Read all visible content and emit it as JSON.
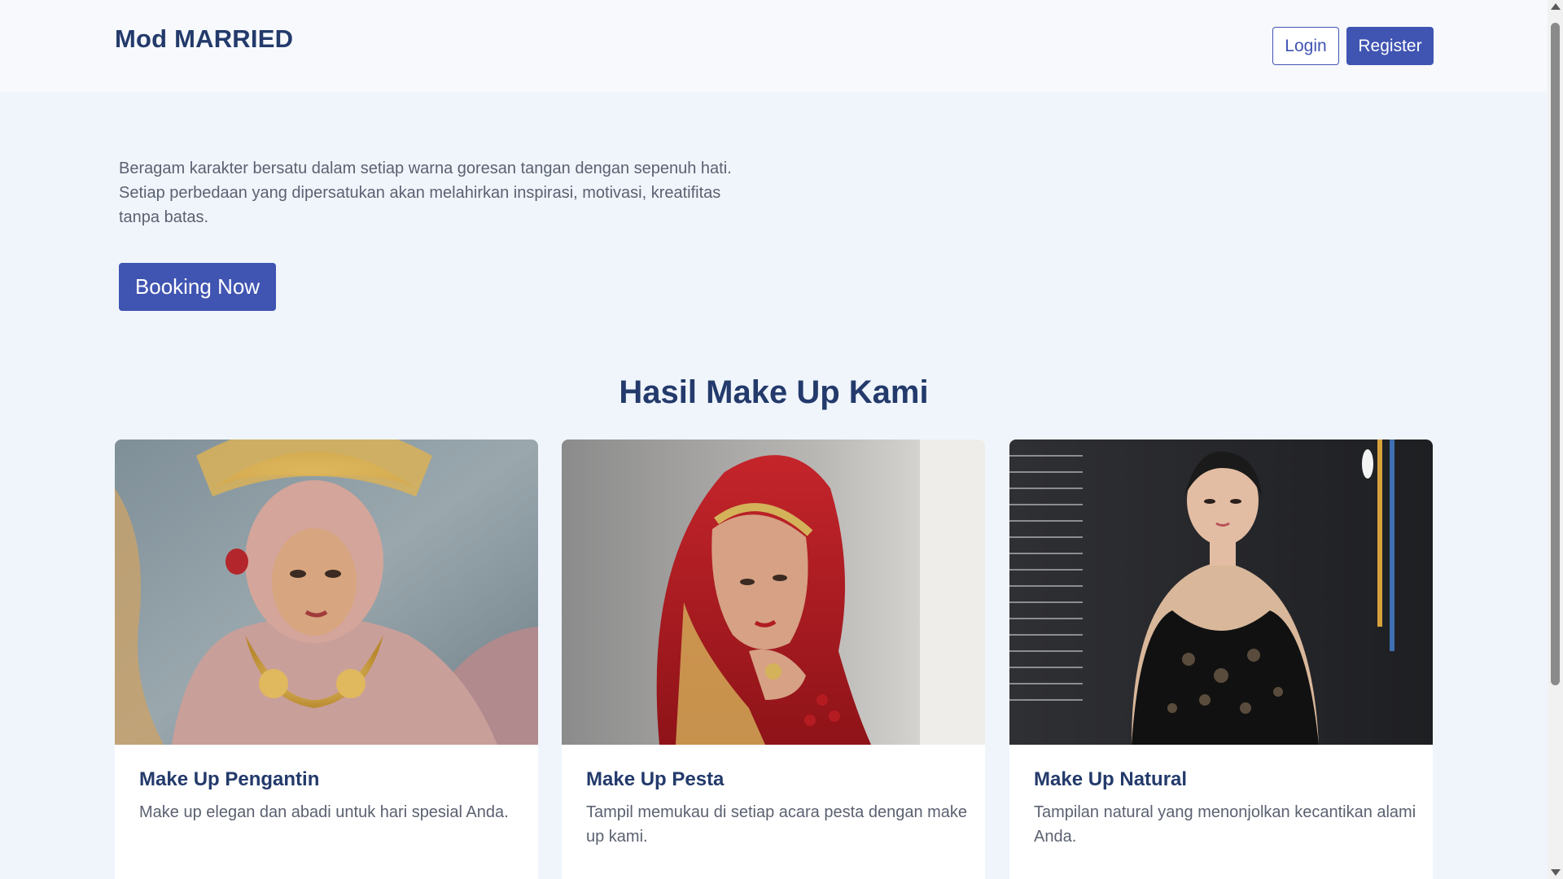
{
  "navbar": {
    "brand": "Mod MARRIED",
    "login_label": "Login",
    "register_label": "Register"
  },
  "hero": {
    "description": "Beragam karakter bersatu dalam setiap warna goresan tangan dengan sepenuh hati. Setiap perbedaan yang dipersatukan akan melahirkan inspirasi, motivasi, kreatifitas tanpa batas.",
    "cta_label": "Booking Now"
  },
  "gallery": {
    "title": "Hasil Make Up Kami",
    "cards": [
      {
        "title": "Make Up Pengantin",
        "description": "Make up elegan dan abadi untuk hari spesial Anda."
      },
      {
        "title": "Make Up Pesta",
        "description": "Tampil memukau di setiap acara pesta dengan make up kami."
      },
      {
        "title": "Make Up Natural",
        "description": "Tampilan natural yang menonjolkan kecantikan alami Anda."
      }
    ]
  },
  "colors": {
    "accent": "#4054b2",
    "heading": "#233a6b",
    "body_text": "#5b6170",
    "page_bg": "#f0f5fc"
  }
}
